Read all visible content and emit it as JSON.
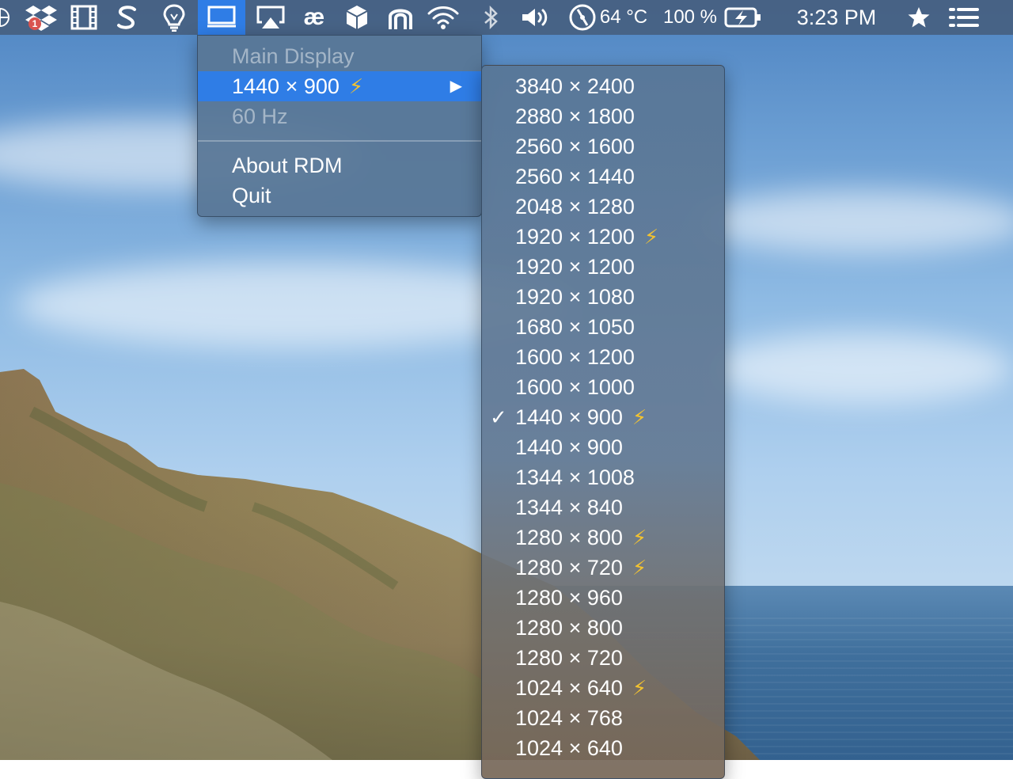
{
  "menubar": {
    "dropbox_badge": "1",
    "temperature": "64 °C",
    "battery_percent": "100 %",
    "clock": "3:23 PM",
    "items": [
      {
        "name": "globe-icon"
      },
      {
        "name": "dropbox-icon"
      },
      {
        "name": "film-icon"
      },
      {
        "name": "scrivener-icon"
      },
      {
        "name": "lightbulb-icon"
      },
      {
        "name": "display-icon",
        "active": true
      },
      {
        "name": "airplay-icon"
      },
      {
        "name": "ae-icon"
      },
      {
        "name": "cube-icon"
      },
      {
        "name": "arch-icon"
      },
      {
        "name": "wifi-icon"
      },
      {
        "name": "bluetooth-icon"
      },
      {
        "name": "volume-icon"
      },
      {
        "name": "temperature-gauge-icon"
      },
      {
        "name": "battery-charging-icon"
      },
      {
        "name": "star-icon"
      },
      {
        "name": "list-icon"
      }
    ]
  },
  "main_menu": {
    "header": "Main Display",
    "current_resolution": "1440 × 900",
    "current_hidpi": true,
    "refresh_rate": "60 Hz",
    "about": "About RDM",
    "quit": "Quit"
  },
  "submenu": {
    "items": [
      {
        "label": "3840 × 2400",
        "hidpi": false,
        "checked": false
      },
      {
        "label": "2880 × 1800",
        "hidpi": false,
        "checked": false
      },
      {
        "label": "2560 × 1600",
        "hidpi": false,
        "checked": false
      },
      {
        "label": "2560 × 1440",
        "hidpi": false,
        "checked": false
      },
      {
        "label": "2048 × 1280",
        "hidpi": false,
        "checked": false
      },
      {
        "label": "1920 × 1200",
        "hidpi": true,
        "checked": false
      },
      {
        "label": "1920 × 1200",
        "hidpi": false,
        "checked": false
      },
      {
        "label": "1920 × 1080",
        "hidpi": false,
        "checked": false
      },
      {
        "label": "1680 × 1050",
        "hidpi": false,
        "checked": false
      },
      {
        "label": "1600 × 1200",
        "hidpi": false,
        "checked": false
      },
      {
        "label": "1600 × 1000",
        "hidpi": false,
        "checked": false
      },
      {
        "label": "1440 × 900",
        "hidpi": true,
        "checked": true
      },
      {
        "label": "1440 × 900",
        "hidpi": false,
        "checked": false
      },
      {
        "label": "1344 × 1008",
        "hidpi": false,
        "checked": false
      },
      {
        "label": "1344 × 840",
        "hidpi": false,
        "checked": false
      },
      {
        "label": "1280 × 800",
        "hidpi": true,
        "checked": false
      },
      {
        "label": "1280 × 720",
        "hidpi": true,
        "checked": false
      },
      {
        "label": "1280 × 960",
        "hidpi": false,
        "checked": false
      },
      {
        "label": "1280 × 800",
        "hidpi": false,
        "checked": false
      },
      {
        "label": "1280 × 720",
        "hidpi": false,
        "checked": false
      },
      {
        "label": "1024 × 640",
        "hidpi": true,
        "checked": false
      },
      {
        "label": "1024 × 768",
        "hidpi": false,
        "checked": false
      },
      {
        "label": "1024 × 640",
        "hidpi": false,
        "checked": false
      }
    ]
  },
  "colors": {
    "highlight": "#2f7de6",
    "bolt": "#f2c230",
    "menubar": "#466080"
  }
}
